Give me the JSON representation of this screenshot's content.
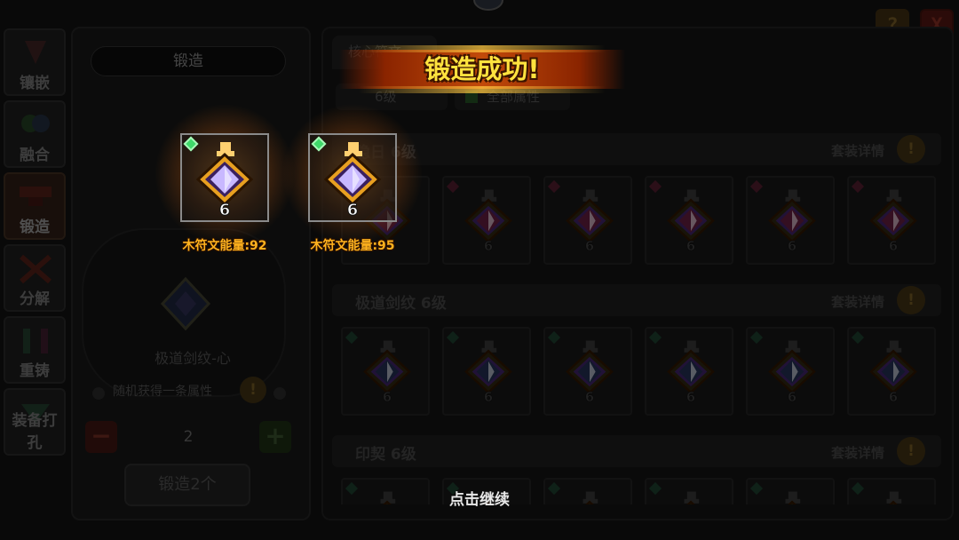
{
  "background_ui": {
    "side_tabs": [
      {
        "label": "镶嵌",
        "active": false
      },
      {
        "label": "融合",
        "active": false
      },
      {
        "label": "锻造",
        "active": true
      },
      {
        "label": "分解",
        "active": false
      },
      {
        "label": "重铸",
        "active": false
      },
      {
        "label": "装备打孔",
        "active": false
      }
    ],
    "left_panel": {
      "title": "锻造",
      "item_name": "极道剑纹-心",
      "random_attribute_note": "随机获得一条属性",
      "quantity": "2",
      "forge_button_label": "锻造2个"
    },
    "right_panel": {
      "tab_label": "核心符文",
      "level_filter": "6级",
      "attribute_filter": "全部属性",
      "sets": [
        {
          "name": "隐日 6级",
          "detail_label": "套装详情",
          "slot_color": "#5a1a3a"
        },
        {
          "name": "极道剑纹 6级",
          "detail_label": "套装详情",
          "slot_color": "#1f2a4a"
        },
        {
          "name": "印契 6级",
          "detail_label": "套装详情",
          "slot_color": "#1a2a2a"
        }
      ],
      "slot_level": "6"
    },
    "help_icon": "?",
    "close_icon": "X"
  },
  "popup": {
    "title": "锻造成功!",
    "results": [
      {
        "label": "木符文能量:92",
        "level": "6"
      },
      {
        "label": "木符文能量:95",
        "level": "6"
      }
    ],
    "continue_hint": "点击继续"
  },
  "colors": {
    "banner": "#c24a0a",
    "title_text": "#ffe23e",
    "result_label": "#ffb21e",
    "rune_gold": "#e8a020",
    "rune_crystal": "#c8b8ff",
    "green_gem": "#3fd86a"
  },
  "icons": {
    "rune": "diamond-rune-icon",
    "gem": "green-gem-icon",
    "info": "exclamation-icon"
  }
}
